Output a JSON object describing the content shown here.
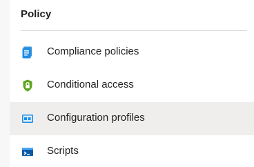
{
  "section": {
    "title": "Policy"
  },
  "nav": {
    "items": [
      {
        "label": "Compliance policies",
        "icon": "compliance-policy-icon",
        "active": false
      },
      {
        "label": "Conditional access",
        "icon": "shield-lock-icon",
        "active": false
      },
      {
        "label": "Configuration profiles",
        "icon": "configuration-profile-icon",
        "active": true
      },
      {
        "label": "Scripts",
        "icon": "terminal-script-icon",
        "active": false
      }
    ]
  },
  "colors": {
    "active_background": "#f0eeed",
    "accent_blue": "#1f8ce6",
    "shield_green": "#5ea51d",
    "script_dark_blue": "#0c5aa6"
  }
}
